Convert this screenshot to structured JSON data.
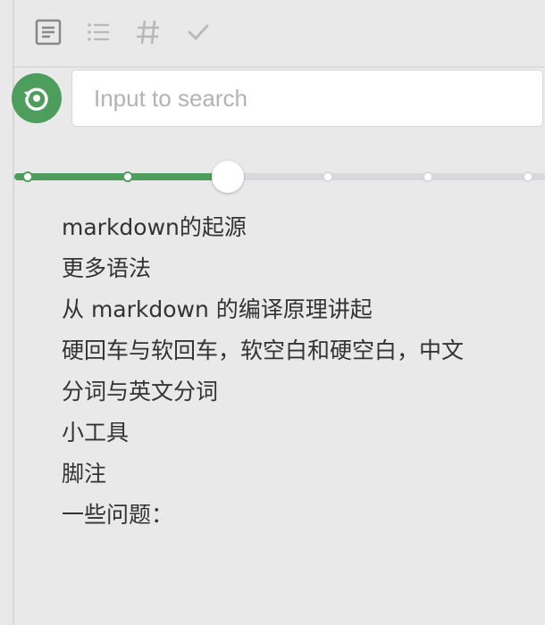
{
  "toolbar": {
    "buttons": [
      {
        "name": "outline-view",
        "icon": "document-outline-icon"
      },
      {
        "name": "list-view",
        "icon": "bulleted-list-icon"
      },
      {
        "name": "heading-view",
        "icon": "hash-icon"
      },
      {
        "name": "task-view",
        "icon": "checkmark-icon"
      }
    ]
  },
  "search": {
    "placeholder": "Input to search",
    "value": "",
    "history_icon": "history-restore-icon"
  },
  "slider": {
    "steps": 6,
    "current_step": 2
  },
  "toc": {
    "items": [
      "markdown的起源",
      "更多语法",
      "从 markdown 的编译原理讲起",
      "硬回车与软回车，软空白和硬空白，中文",
      "分词与英文分词",
      "小工具",
      "脚注",
      "一些问题："
    ]
  },
  "colors": {
    "accent": "#4d9e5c",
    "background": "#e9e9e9",
    "icon": "#888888",
    "text": "#333333"
  }
}
